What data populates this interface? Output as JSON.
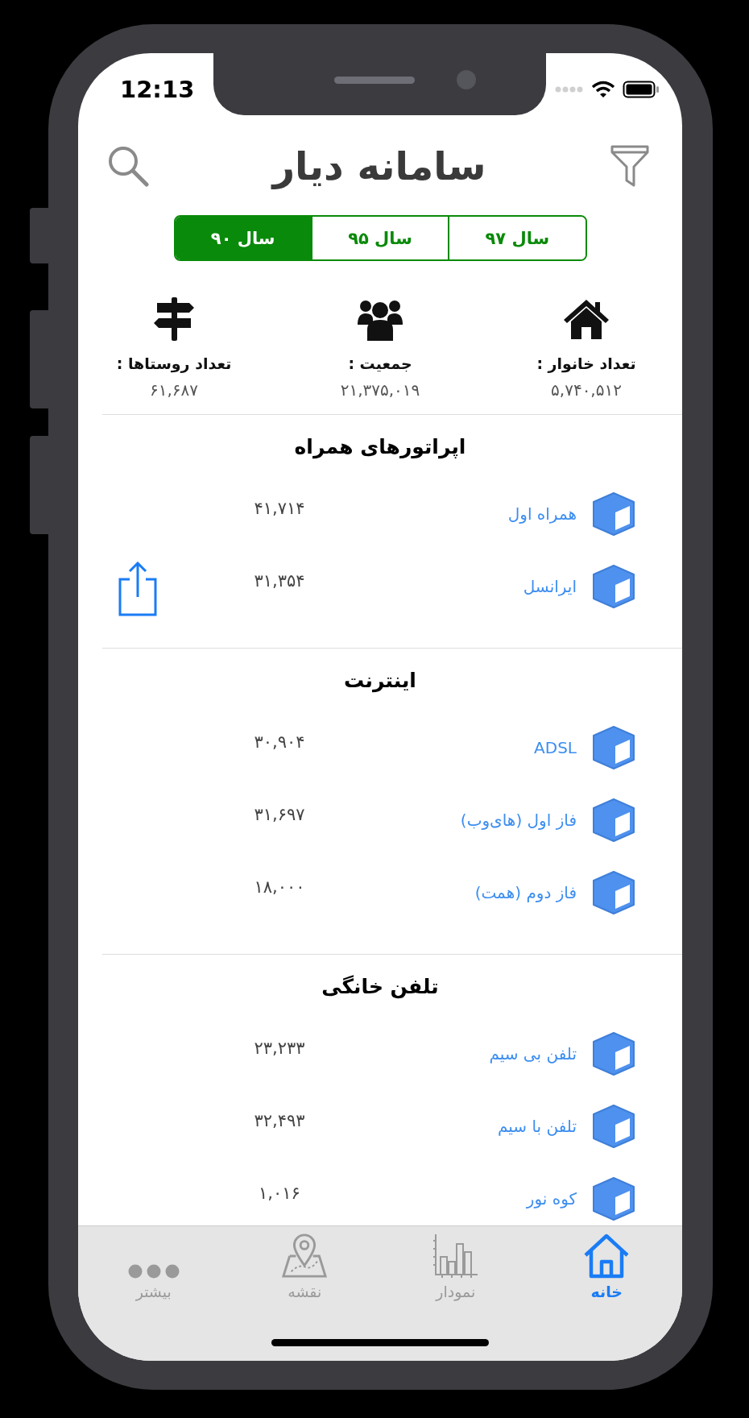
{
  "status_bar": {
    "time": "12:13"
  },
  "header": {
    "title": "سامانه دیار"
  },
  "year_tabs": [
    {
      "label": "سال ۹۷",
      "selected": false
    },
    {
      "label": "سال ۹۵",
      "selected": false
    },
    {
      "label": "سال ۹۰",
      "selected": true
    }
  ],
  "stats": [
    {
      "label": "تعداد خانوار :",
      "value": "۵,۷۴۰,۵۱۲"
    },
    {
      "label": "جمعیت :",
      "value": "۲۱,۳۷۵,۰۱۹"
    },
    {
      "label": "تعداد روستاها :",
      "value": "۶۱,۶۸۷"
    }
  ],
  "sections": [
    {
      "title": "اپراتورهای همراه",
      "rows": [
        {
          "name": "همراه اول",
          "value": "۴۱,۷۱۴"
        },
        {
          "name": "ایرانسل",
          "value": "۳۱,۳۵۴"
        }
      ]
    },
    {
      "title": "اینترنت",
      "rows": [
        {
          "name": "ADSL",
          "value": "۳۰,۹۰۴"
        },
        {
          "name": "فاز اول (های‌وب)",
          "value": "۳۱,۶۹۷"
        },
        {
          "name": "فاز دوم (همت)",
          "value": "۱۸,۰۰۰"
        }
      ]
    },
    {
      "title": "تلفن خانگی",
      "rows": [
        {
          "name": "تلفن بی سیم",
          "value": "۲۳,۲۳۳"
        },
        {
          "name": "تلفن با سیم",
          "value": "۳۲,۴۹۳"
        },
        {
          "name": "کوه نور",
          "value": "۱,۰۱۶"
        }
      ]
    }
  ],
  "tab_bar": [
    {
      "label": "خانه",
      "selected": true
    },
    {
      "label": "نمودار",
      "selected": false
    },
    {
      "label": "نقشه",
      "selected": false
    },
    {
      "label": "بیشتر",
      "selected": false
    }
  ]
}
